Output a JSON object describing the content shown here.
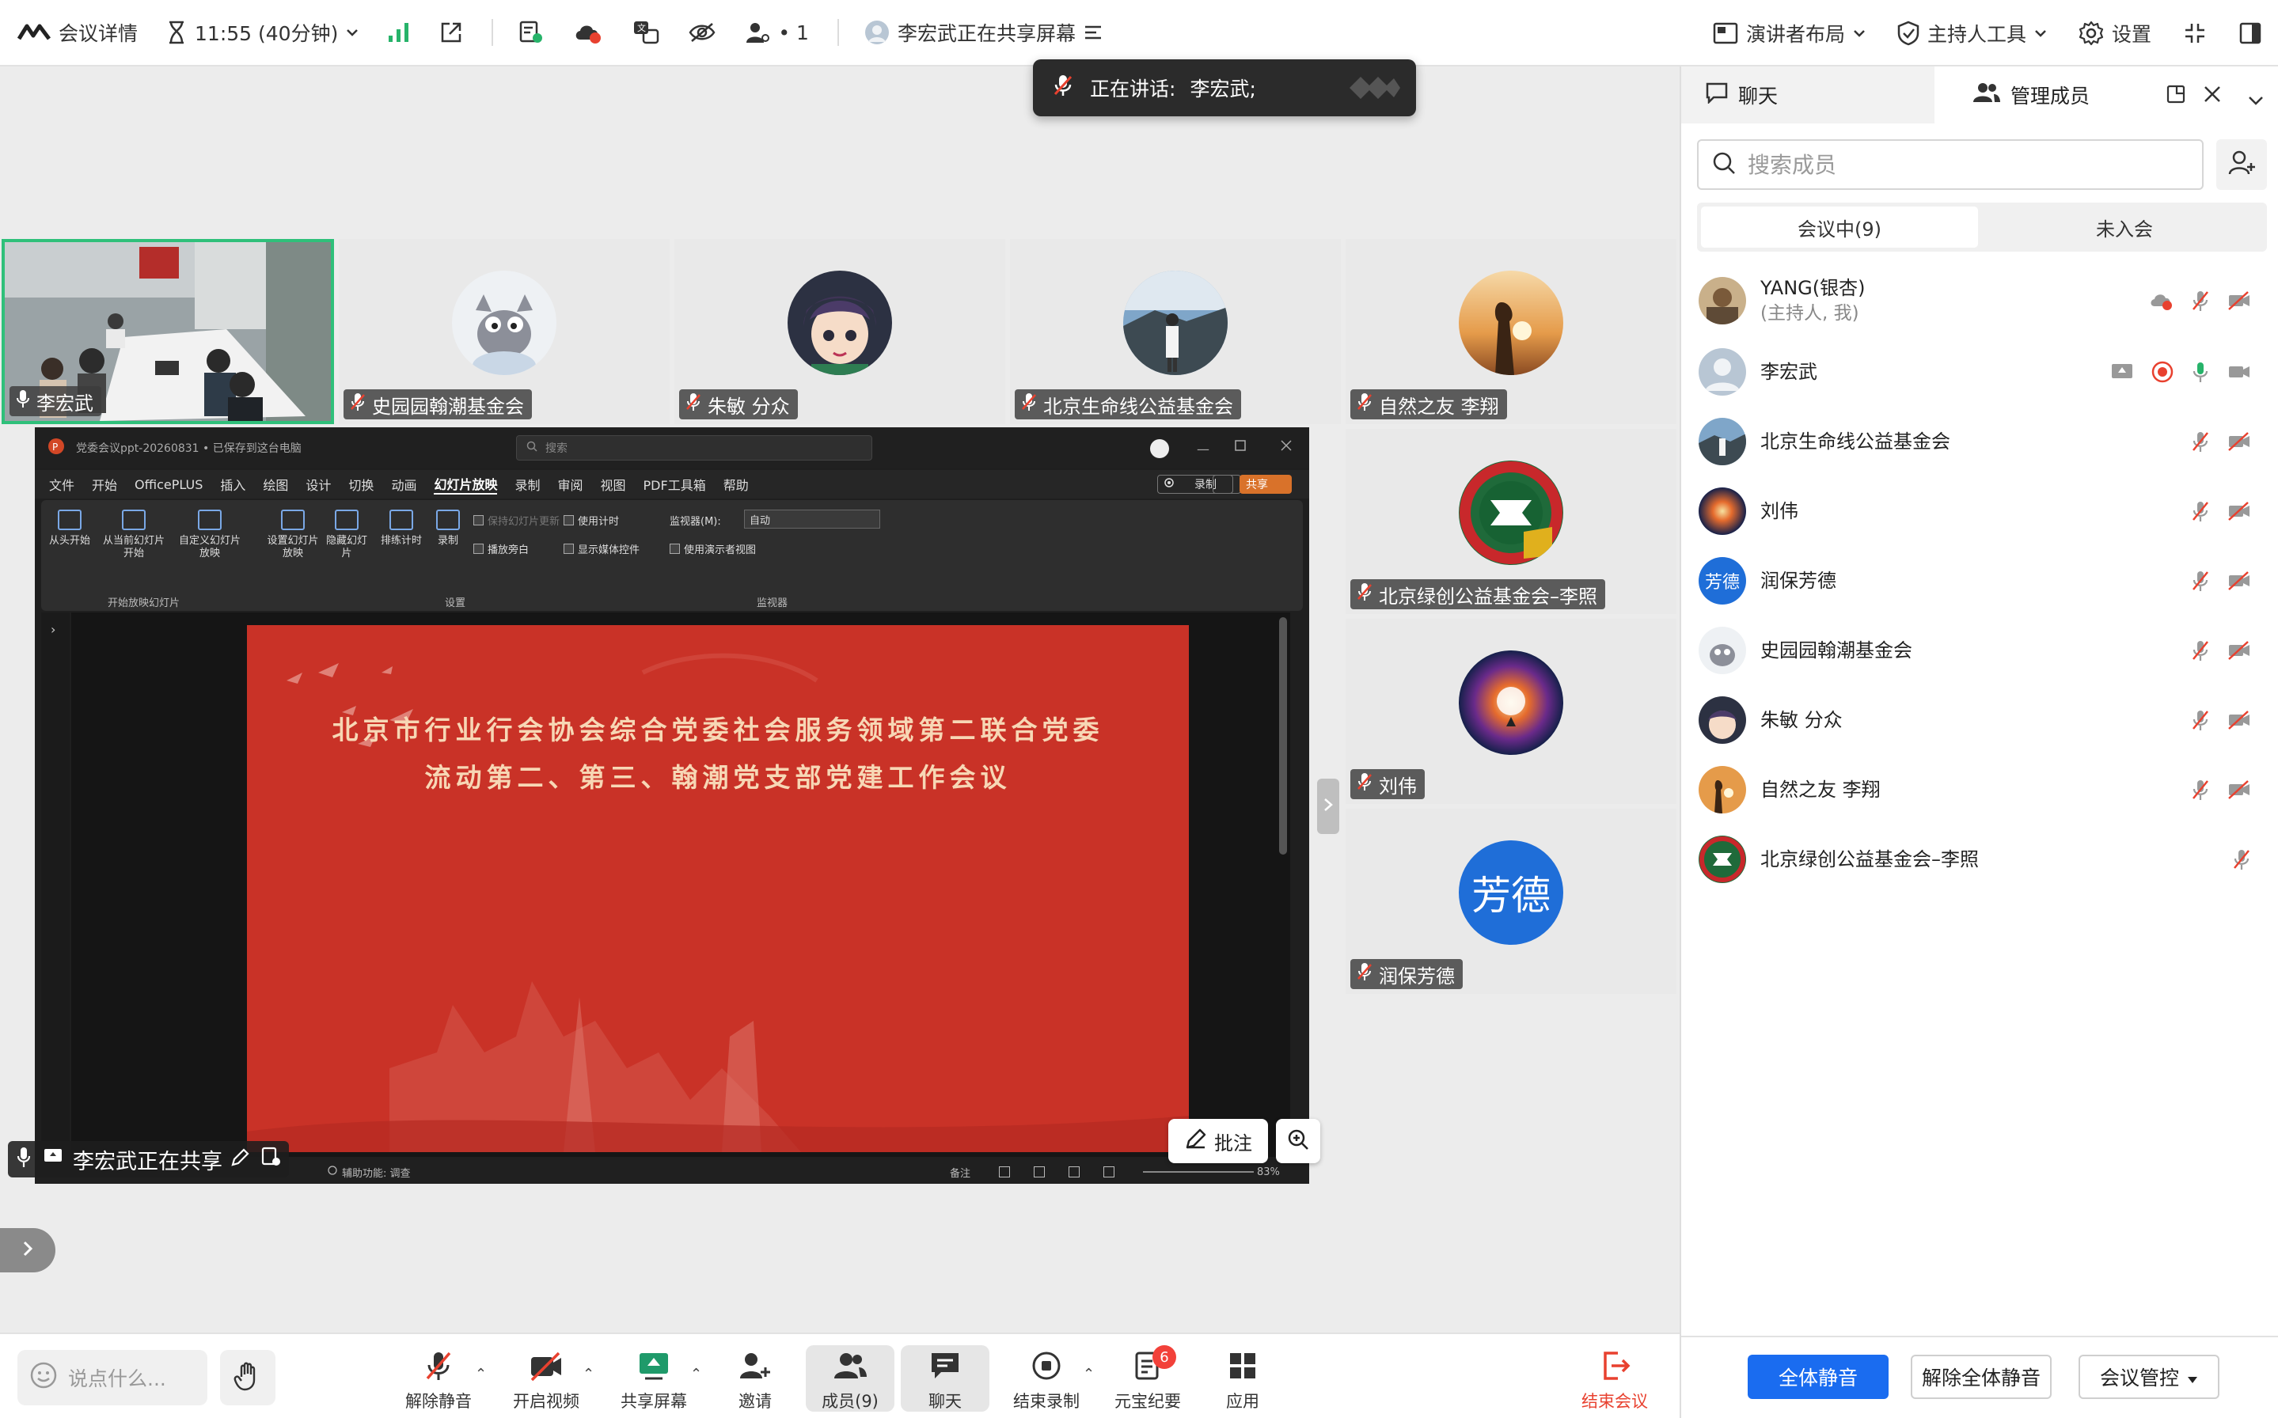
{
  "topbar": {
    "meeting_info": "会议详情",
    "time": "11:55 (40分钟)",
    "participant_count": "• 1",
    "sharing_status": "李宏武正在共享屏幕",
    "layout": "演讲者布局",
    "host_tools": "主持人工具",
    "settings": "设置"
  },
  "toast": {
    "label": "正在讲话:",
    "speaker": "李宏武;"
  },
  "tiles": [
    {
      "name": "李宏武"
    },
    {
      "name": "史园园翰潮基金会"
    },
    {
      "name": "朱敏 分众"
    },
    {
      "name": "北京生命线公益基金会"
    },
    {
      "name": "自然之友 李翔"
    },
    {
      "name": "北京绿创公益基金会–李照"
    },
    {
      "name": "刘伟"
    },
    {
      "name": "润保芳德",
      "initials": "芳德"
    }
  ],
  "share": {
    "window_title": "党委会议ppt-20260831 • 已保存到这台电脑",
    "search_placeholder": "搜索",
    "menu": [
      "文件",
      "开始",
      "OfficePLUS",
      "插入",
      "绘图",
      "设计",
      "切换",
      "动画",
      "幻灯片放映",
      "录制",
      "审阅",
      "视图",
      "PDF工具箱",
      "帮助"
    ],
    "record_label": "录制",
    "share_label": "共享",
    "ribbon": {
      "btn_from_start": "从头开始",
      "btn_from_current": "从当前幻灯片开始",
      "btn_custom": "自定义幻灯片放映",
      "group_start": "开始放映幻灯片",
      "btn_setup": "设置幻灯片放映",
      "btn_hide": "隐藏幻灯片",
      "btn_rehearse": "排练计时",
      "btn_record": "录制",
      "chk_keep_updated": "保持幻灯片更新",
      "chk_timing": "使用计时",
      "chk_narration": "播放旁白",
      "chk_media": "显示媒体控件",
      "group_setup": "设置",
      "monitor_label": "监视器(M):",
      "monitor_value": "自动",
      "chk_presenter": "使用演示者视图",
      "group_monitor": "监视器"
    },
    "slide_line1": "北京市行业行会协会综合党委社会服务领域第二联合党委",
    "slide_line2": "流动第二、第三、翰潮党支部党建工作会议",
    "status_accessibility": "辅助功能: 调查",
    "status_notes": "备注",
    "status_zoom": "83%",
    "annotate": "批注",
    "sharing_bar": "李宏武正在共享"
  },
  "bottombar": {
    "say_placeholder": "说点什么...",
    "unmute": "解除静音",
    "video": "开启视频",
    "share": "共享屏幕",
    "invite": "邀请",
    "members": "成员(9)",
    "chat": "聊天",
    "end_record": "结束录制",
    "yuanbao": "元宝纪要",
    "yuanbao_badge": "6",
    "apps": "应用",
    "end_meeting": "结束会议"
  },
  "panel": {
    "tab_chat": "聊天",
    "tab_members": "管理成员",
    "search_placeholder": "搜索成员",
    "seg_in_meeting": "会议中(9)",
    "seg_not_joined": "未入会",
    "members": [
      {
        "name": "YANG(银杏)",
        "sub": "(主持人, 我)"
      },
      {
        "name": "李宏武",
        "sub": ""
      },
      {
        "name": "北京生命线公益基金会",
        "sub": ""
      },
      {
        "name": "刘伟",
        "sub": ""
      },
      {
        "name": "润保芳德",
        "sub": "",
        "initials": "芳德"
      },
      {
        "name": "史园园翰潮基金会",
        "sub": ""
      },
      {
        "name": "朱敏 分众",
        "sub": ""
      },
      {
        "name": "自然之友 李翔",
        "sub": ""
      },
      {
        "name": "北京绿创公益基金会–李照",
        "sub": ""
      }
    ],
    "mute_all": "全体静音",
    "unmute_all": "解除全体静音",
    "meeting_control": "会议管控"
  },
  "colors": {
    "accent_blue": "#1a6cf0",
    "active_green": "#2fc07a",
    "danger_red": "#e8412f",
    "slide_red": "#c93227"
  }
}
